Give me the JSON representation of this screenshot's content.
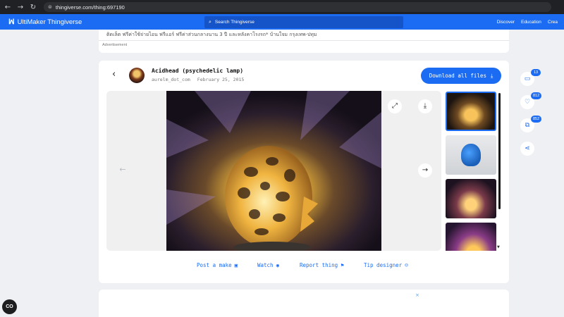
{
  "browser": {
    "url": "thingiverse.com/thing:697190"
  },
  "header": {
    "logo_text": "UltiMaker Thingiverse",
    "search_placeholder": "Search Thingiverse",
    "nav": [
      "Discover",
      "Education",
      "Crea"
    ]
  },
  "ad_top": {
    "text": "ติดเล็ต ฟรีค่าใช้จ่ายไอน ฟรีแอร์ ฟรีค่าส่วนกลางนาน 3 ปี และหลังคาโรงรถ* บ้านใจม กรุงเทพ-ปทุม",
    "label": "Advertisement"
  },
  "thing": {
    "title": "Acidhead (psychedelic lamp)",
    "author": "aurelm_dot_com",
    "date": "February 25, 2015",
    "download_label": "Download all files"
  },
  "viewer": {
    "thumbnail_count": 4,
    "active_index": 0
  },
  "actions": {
    "post_make": "Post a make",
    "watch": "Watch",
    "report": "Report thing",
    "tip": "Tip designer"
  },
  "sidebar": {
    "comments_count": "13",
    "likes_count": "812",
    "collections_count": "852"
  },
  "ad_bottom": {
    "close": "×"
  },
  "colors": {
    "brand": "#1b6cf2",
    "page_bg": "#eef0f3"
  }
}
